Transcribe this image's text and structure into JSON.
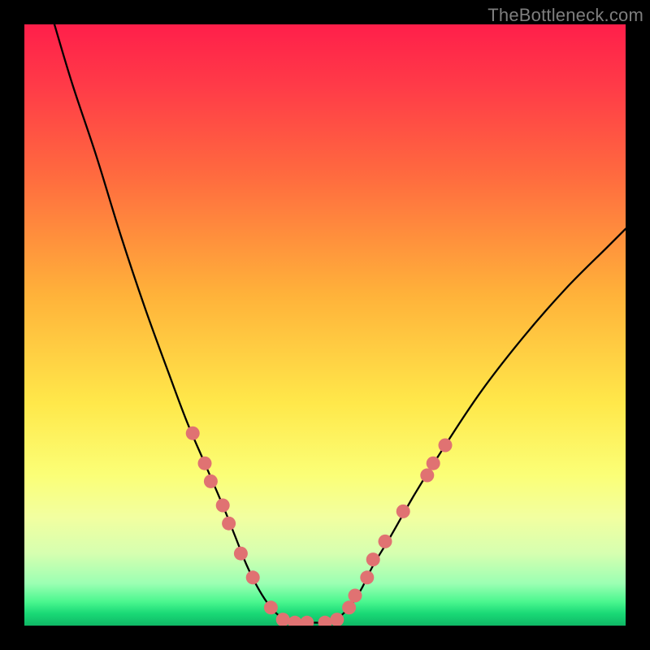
{
  "watermark": "TheBottleneck.com",
  "chart_data": {
    "type": "line",
    "title": "",
    "xlabel": "",
    "ylabel": "",
    "xlim": [
      0,
      100
    ],
    "ylim": [
      0,
      100
    ],
    "grid": false,
    "legend": false,
    "background": "rainbow-vertical-gradient",
    "curves": [
      {
        "name": "left-branch",
        "x": [
          5,
          8,
          12,
          16,
          20,
          24,
          27,
          30,
          33,
          35,
          37,
          39,
          41,
          43
        ],
        "y": [
          100,
          90,
          78,
          65,
          53,
          42,
          34,
          27,
          20,
          15,
          10,
          6,
          3,
          1
        ]
      },
      {
        "name": "right-branch",
        "x": [
          52,
          54,
          56,
          58,
          61,
          65,
          70,
          76,
          83,
          90,
          97,
          100
        ],
        "y": [
          1,
          3,
          6,
          10,
          15,
          22,
          30,
          39,
          48,
          56,
          63,
          66
        ]
      }
    ],
    "flat_segment": {
      "x": [
        43,
        52
      ],
      "y": 0.5
    },
    "markers": {
      "name": "highlighted-points",
      "color": "#e07272",
      "points": [
        {
          "x": 28,
          "y": 32
        },
        {
          "x": 30,
          "y": 27
        },
        {
          "x": 31,
          "y": 24
        },
        {
          "x": 33,
          "y": 20
        },
        {
          "x": 34,
          "y": 17
        },
        {
          "x": 36,
          "y": 12
        },
        {
          "x": 38,
          "y": 8
        },
        {
          "x": 41,
          "y": 3
        },
        {
          "x": 43,
          "y": 1
        },
        {
          "x": 45,
          "y": 0.5
        },
        {
          "x": 47,
          "y": 0.5
        },
        {
          "x": 50,
          "y": 0.5
        },
        {
          "x": 52,
          "y": 1
        },
        {
          "x": 54,
          "y": 3
        },
        {
          "x": 55,
          "y": 5
        },
        {
          "x": 57,
          "y": 8
        },
        {
          "x": 58,
          "y": 11
        },
        {
          "x": 60,
          "y": 14
        },
        {
          "x": 63,
          "y": 19
        },
        {
          "x": 67,
          "y": 25
        },
        {
          "x": 68,
          "y": 27
        },
        {
          "x": 70,
          "y": 30
        }
      ]
    }
  }
}
